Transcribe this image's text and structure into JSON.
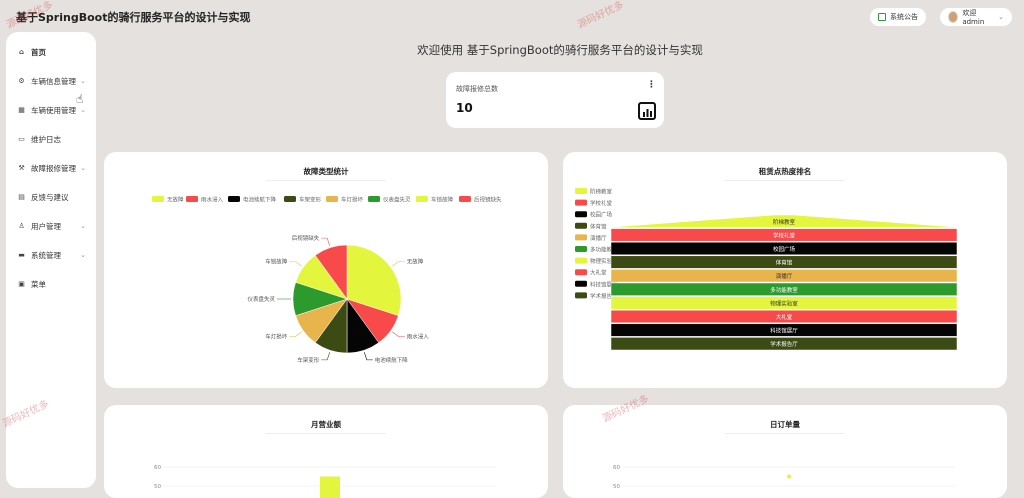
{
  "app": {
    "title": "基于SpringBoot的骑行服务平台的设计与实现"
  },
  "topbar": {
    "notice_label": "系统公告",
    "user_label": "欢迎 admin"
  },
  "sidebar": {
    "items": [
      {
        "label": "首页",
        "icon": "home-icon",
        "expandable": false
      },
      {
        "label": "车辆信息管理",
        "icon": "gear-icon",
        "expandable": true
      },
      {
        "label": "车辆使用管理",
        "icon": "grid-icon",
        "expandable": true
      },
      {
        "label": "维护日志",
        "icon": "toolbox-icon",
        "expandable": false
      },
      {
        "label": "故障报修管理",
        "icon": "wrench-icon",
        "expandable": true
      },
      {
        "label": "反馈与建议",
        "icon": "document-icon",
        "expandable": false
      },
      {
        "label": "用户管理",
        "icon": "user-icon",
        "expandable": true
      },
      {
        "label": "系统管理",
        "icon": "settings-icon",
        "expandable": true
      },
      {
        "label": "菜单",
        "icon": "menu-icon",
        "expandable": false
      }
    ]
  },
  "welcome": {
    "text": "欢迎使用 基于SpringBoot的骑行服务平台的设计与实现"
  },
  "stat": {
    "label": "故障报修总数",
    "value": "10"
  },
  "watermark": {
    "text": "源码好优多"
  },
  "chart_data": [
    {
      "type": "pie",
      "title": "故障类型统计",
      "legend_position": "top",
      "categories": [
        "无故障",
        "雨水浸入",
        "电池续航下降",
        "车架变形",
        "车灯损坏",
        "仪表盘失灵",
        "车锁故障",
        "后视镜缺失"
      ],
      "values": [
        3,
        1,
        1,
        1,
        1,
        1,
        1,
        1
      ],
      "colors": [
        "#e3f53c",
        "#f84a4a",
        "#050505",
        "#3c4a14",
        "#e8b44c",
        "#2d9a2d",
        "#e3f53c",
        "#f84a4a"
      ]
    },
    {
      "type": "funnel",
      "title": "租赁点热度排名",
      "legend_position": "left",
      "categories": [
        "阶梯教室",
        "学校礼堂",
        "校园广场",
        "体育馆",
        "演播厅",
        "多功能教室",
        "物理实验室",
        "大礼堂",
        "科技馆展厅",
        "学术报告厅"
      ],
      "values": [
        10,
        9,
        8,
        7,
        6,
        5,
        4,
        3,
        2,
        1
      ],
      "colors": [
        "#e3f53c",
        "#f84a4a",
        "#050505",
        "#3c4a14",
        "#e8b44c",
        "#2d9a2d",
        "#e3f53c",
        "#f84a4a",
        "#050505",
        "#3c4a14"
      ]
    },
    {
      "type": "bar",
      "title": "月营业额",
      "ylim": [
        0,
        60
      ],
      "yticks": [
        60,
        50
      ],
      "categories": [
        ""
      ],
      "values": [
        55
      ],
      "colors": [
        "#e3f53c"
      ]
    },
    {
      "type": "scatter",
      "title": "日订单量",
      "ylim": [
        0,
        60
      ],
      "yticks": [
        60,
        50
      ],
      "values": [
        55
      ],
      "colors": [
        "#e3f53c"
      ]
    }
  ]
}
